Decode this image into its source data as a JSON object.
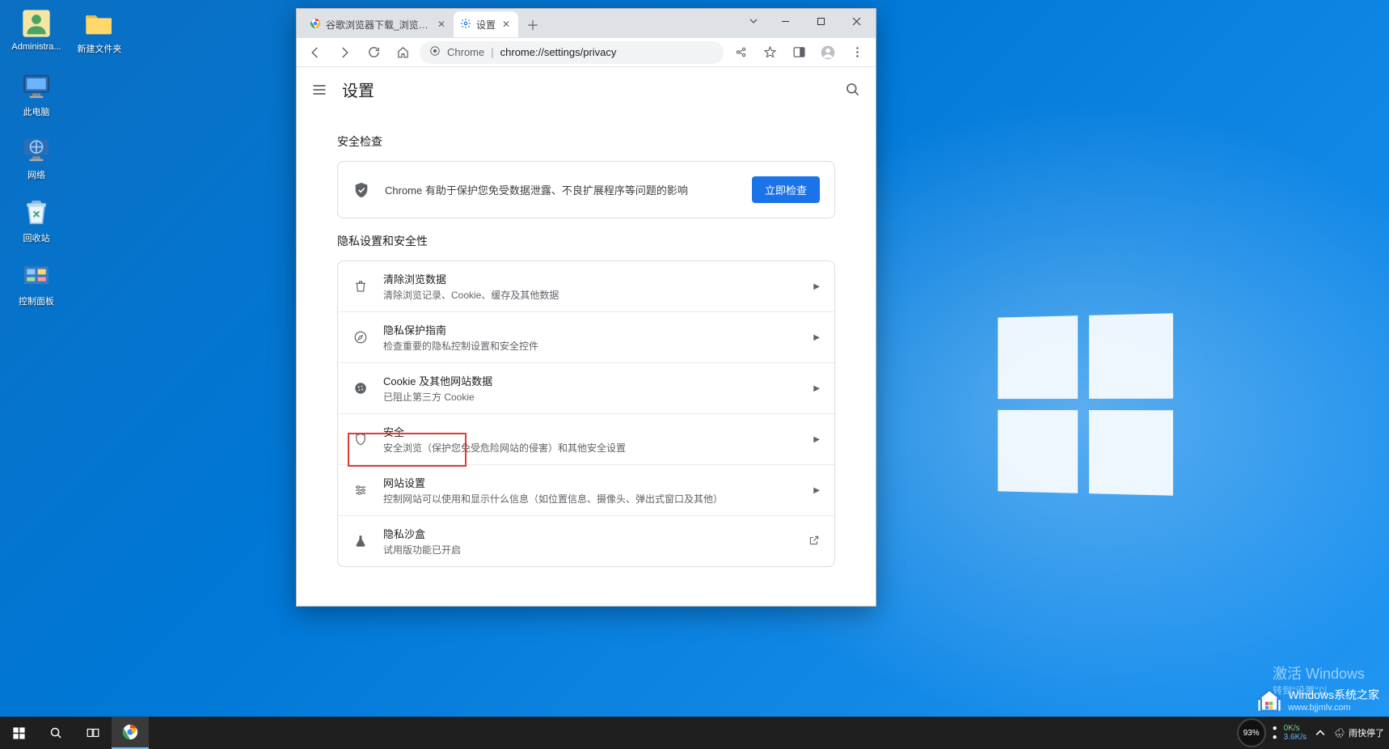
{
  "desktop": {
    "icons": [
      {
        "id": "admin",
        "label": "Administra..."
      },
      {
        "id": "newfolder",
        "label": "新建文件夹"
      },
      {
        "id": "thispc",
        "label": "此电脑"
      },
      {
        "id": "network",
        "label": "网络"
      },
      {
        "id": "recycle",
        "label": "回收站"
      },
      {
        "id": "control",
        "label": "控制面板"
      }
    ]
  },
  "chrome": {
    "tabs": [
      {
        "label": "谷歌浏览器下载_浏览器官网入口",
        "active": false
      },
      {
        "label": "设置",
        "active": true
      }
    ],
    "address": {
      "prefix": "Chrome",
      "url": "chrome://settings/privacy"
    }
  },
  "settings": {
    "page_title": "设置",
    "safety_check_heading": "安全检查",
    "safety_text": "Chrome 有助于保护您免受数据泄露、不良扩展程序等问题的影响",
    "check_now": "立即检查",
    "privacy_heading": "隐私设置和安全性",
    "rows": [
      {
        "icon": "trash",
        "title": "清除浏览数据",
        "sub": "清除浏览记录、Cookie、缓存及其他数据",
        "action": "arrow"
      },
      {
        "icon": "compass",
        "title": "隐私保护指南",
        "sub": "检查重要的隐私控制设置和安全控件",
        "action": "arrow"
      },
      {
        "icon": "cookie",
        "title": "Cookie 及其他网站数据",
        "sub": "已阻止第三方 Cookie",
        "action": "arrow"
      },
      {
        "icon": "shield",
        "title": "安全",
        "sub": "安全浏览（保护您免受危险网站的侵害）和其他安全设置",
        "action": "arrow"
      },
      {
        "icon": "sliders",
        "title": "网站设置",
        "sub": "控制网站可以使用和显示什么信息（如位置信息、摄像头、弹出式窗口及其他）",
        "action": "arrow"
      },
      {
        "icon": "flask",
        "title": "隐私沙盒",
        "sub": "试用版功能已开启",
        "action": "external"
      }
    ]
  },
  "activate": {
    "line1": "激活 Windows",
    "line2": "转到\"设置\"以"
  },
  "watermark": {
    "brand": "Windows系统之家",
    "url": "www.bjjmlv.com"
  },
  "taskbar": {
    "meter": "93%",
    "net_up": "0K/s",
    "net_dn": "3.6K/s",
    "weather": "雨快停了"
  }
}
